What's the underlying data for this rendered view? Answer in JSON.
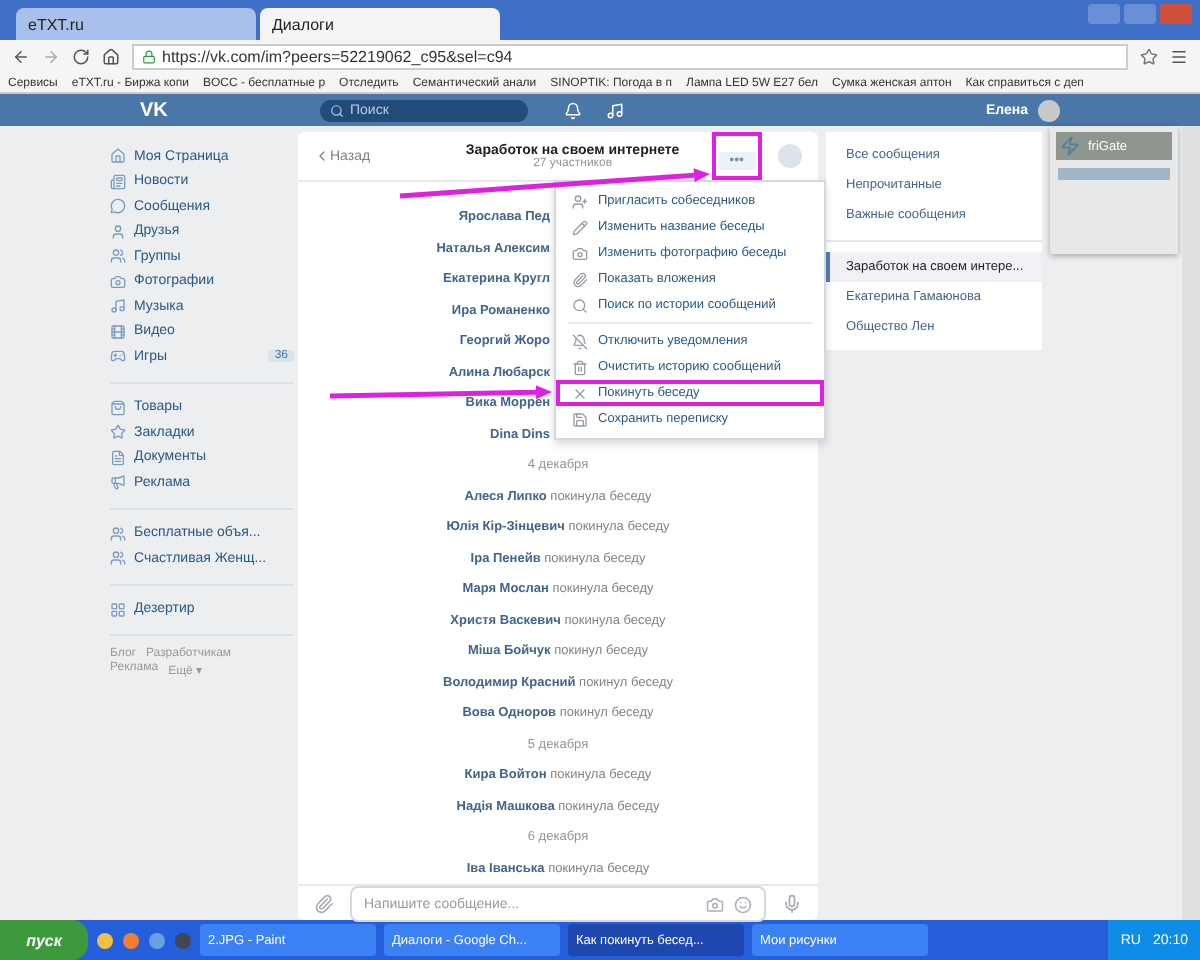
{
  "browser": {
    "tabs": [
      {
        "label": "eTXT.ru",
        "selected": false
      },
      {
        "label": "Диалоги",
        "selected": true
      }
    ],
    "url": "https://vk.com/im?peers=52219062_c95&sel=c94",
    "bookmarks": [
      "Сервисы",
      "eTXT.ru - Биржа копи",
      "BOCC - бесплатные р",
      "Отследить",
      "Семантический анали",
      "SINOPTIK: Погода в п",
      "Лампа LED 5W E27 бел",
      "Сумка женская аптон",
      "Как справиться с деп"
    ]
  },
  "header": {
    "logo": "VK",
    "search": {
      "placeholder": "Поиск"
    },
    "user": "Елена"
  },
  "sidebar": {
    "groups": [
      [
        {
          "kind": "home",
          "label": "Моя Страница"
        },
        {
          "kind": "news",
          "label": "Новости"
        },
        {
          "kind": "messages",
          "label": "Сообщения"
        },
        {
          "kind": "friends",
          "label": "Друзья"
        },
        {
          "kind": "groups",
          "label": "Группы"
        },
        {
          "kind": "photos",
          "label": "Фотографии"
        },
        {
          "kind": "music",
          "label": "Музыка"
        },
        {
          "kind": "video",
          "label": "Видео"
        },
        {
          "kind": "games",
          "label": "Игры",
          "badge": "36"
        }
      ],
      [
        {
          "kind": "goods",
          "label": "Товары"
        },
        {
          "kind": "bookmarks",
          "label": "Закладки"
        },
        {
          "kind": "docs",
          "label": "Документы"
        },
        {
          "kind": "ads",
          "label": "Реклама"
        }
      ],
      [
        {
          "kind": "groups",
          "label": "Бесплатные объя..."
        },
        {
          "kind": "groups",
          "label": "Счастливая Женщ..."
        }
      ],
      [
        {
          "kind": "apps",
          "label": "Дезертир"
        }
      ]
    ],
    "footer": [
      "Блог",
      "Разработчикам",
      "Реклама",
      "Ещё ▾"
    ]
  },
  "chat": {
    "back": "Назад",
    "title": "Заработок на своем интернете",
    "subtitle": "27 участников",
    "more": {
      "label": "•••",
      "highlighted": true
    },
    "top_rows": [
      "Ярослава Пед",
      "Наталья Алексим",
      "Екатерина Кругл",
      "Ира Романенко",
      "Георгий Жоро",
      "Алина Любарск",
      "Вика Моррен",
      "Dina Dins"
    ],
    "blocks": [
      {
        "date": "4 декабря",
        "rows": [
          {
            "name": "Алеся Липко",
            "action": "покинула беседу"
          },
          {
            "name": "Юлія Кір-Зінцевич",
            "action": "покинула беседу"
          },
          {
            "name": "Іра Пенейв",
            "action": "покинула беседу"
          },
          {
            "name": "Маря Мослан",
            "action": "покинула беседу"
          },
          {
            "name": "Христя Васкевич",
            "action": "покинула беседу"
          },
          {
            "name": "Міша Бойчук",
            "action": "покинул беседу"
          },
          {
            "name": "Володимир Красний",
            "action": "покинул беседу"
          },
          {
            "name": "Вова Одноров",
            "action": "покинул беседу"
          }
        ]
      },
      {
        "date": "5 декабря",
        "rows": [
          {
            "name": "Кира Войтон",
            "action": "покинула беседу"
          },
          {
            "name": "Надія Машкова",
            "action": "покинула беседу"
          }
        ]
      },
      {
        "date": "6 декабря",
        "rows": [
          {
            "name": "Іва Іванська",
            "action": "покинула беседу"
          }
        ]
      }
    ],
    "compose": {
      "placeholder": "Напишите сообщение..."
    }
  },
  "menu": [
    {
      "kind": "invite",
      "label": "Пригласить собеседников",
      "highlighted": false
    },
    {
      "kind": "rename",
      "label": "Изменить название беседы",
      "highlighted": false
    },
    {
      "kind": "photo",
      "label": "Изменить фотографию беседы",
      "highlighted": false
    },
    {
      "kind": "attachments",
      "label": "Показать вложения",
      "highlighted": false
    },
    {
      "kind": "search",
      "label": "Поиск по истории сообщений",
      "highlighted": false
    },
    {
      "kind": "mute",
      "label": "Отключить уведомления",
      "highlighted": false
    },
    {
      "kind": "clear",
      "label": "Очистить историю сообщений",
      "highlighted": false
    },
    {
      "kind": "leave",
      "label": "Покинуть беседу",
      "highlighted": true
    },
    {
      "kind": "save",
      "label": "Сохранить переписку",
      "highlighted": false
    }
  ],
  "folders": [
    {
      "label": "Все сообщения",
      "selected": false
    },
    {
      "label": "Непрочитанные",
      "selected": false
    },
    {
      "label": "Важные сообщения",
      "selected": false
    }
  ],
  "conversations": [
    {
      "label": "Заработок на своем интере...",
      "selected": true
    },
    {
      "label": "Екатерина Гамаюнова",
      "selected": false
    },
    {
      "label": "Общество Лен",
      "selected": false
    }
  ],
  "extension": {
    "title": "friGate"
  },
  "taskbar": {
    "start": "пуск",
    "tasks": [
      {
        "label": "2.JPG - Paint",
        "selected": false
      },
      {
        "label": "Диалоги - Google Ch...",
        "selected": false
      },
      {
        "label": "Как покинуть бесед...",
        "selected": true
      },
      {
        "label": "Мои рисунки",
        "selected": false
      }
    ],
    "lang": "RU",
    "time": "20:10"
  }
}
